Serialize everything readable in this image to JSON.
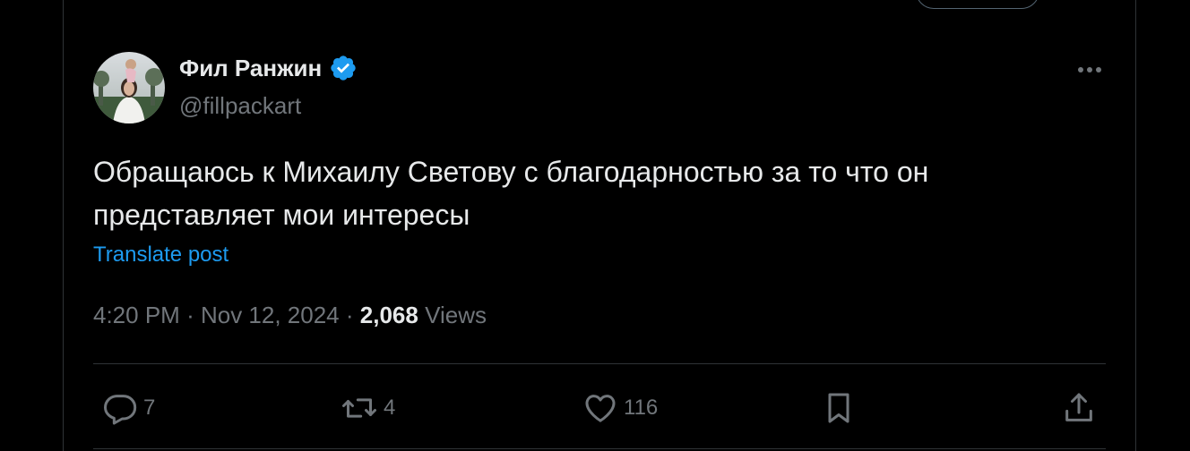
{
  "author": {
    "name": "Фил Ранжин",
    "handle": "@fillpackart",
    "verified": true,
    "avatar_icon": "user-avatar-photo"
  },
  "tweet": {
    "text_line1": "Обращаюсь к Михаилу Светову с благодарностью за то что он",
    "text_line2": "представляет мои интересы",
    "translate_label": "Translate post"
  },
  "meta": {
    "time": "4:20 PM",
    "separator": "·",
    "date": "Nov 12, 2024",
    "views_count": "2,068",
    "views_label": "Views"
  },
  "actions": {
    "replies": "7",
    "reposts": "4",
    "likes": "116"
  },
  "colors": {
    "background": "#000000",
    "text": "#e7e9ea",
    "secondary": "#71767b",
    "accent": "#1d9bf0",
    "border": "#2f3336"
  }
}
